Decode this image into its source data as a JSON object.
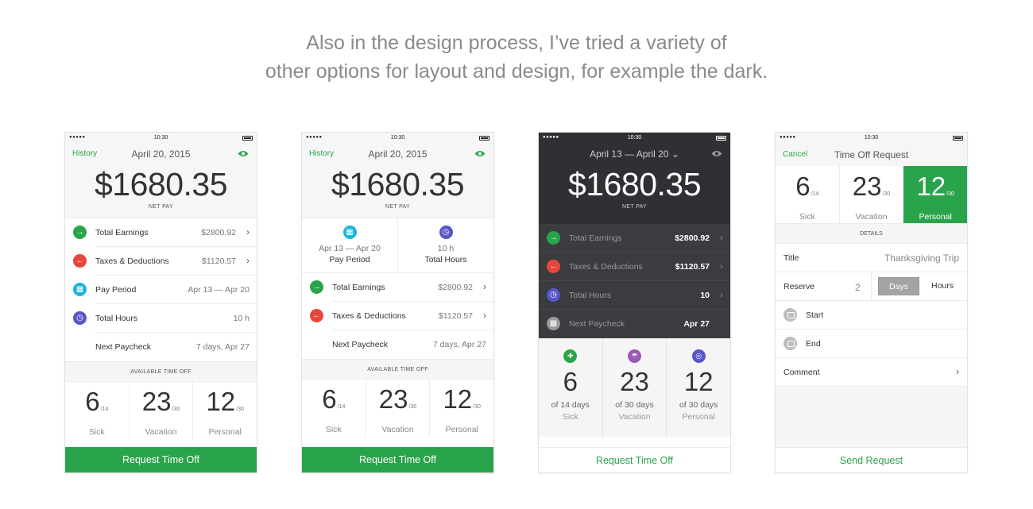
{
  "headline": {
    "line1": "Also in the design process, I’ve tried a variety of",
    "line2": "other options for layout and design, for example the dark."
  },
  "colors": {
    "accent": "#2aa44a",
    "red": "#e8463d",
    "cyan": "#18b4da",
    "violet": "#5a56c8",
    "dark": "#2e3033"
  },
  "status": {
    "dots": "●●●●●",
    "time": "10:30"
  },
  "phone1": {
    "nav_left": "History",
    "title": "April 20, 2015",
    "amount": "$1680.35",
    "netpay": "NET PAY",
    "rows": [
      {
        "icon": "arrow-right-icon",
        "glyph": "→",
        "label": "Total Earnings",
        "value": "$2800.92",
        "chevron": "›"
      },
      {
        "icon": "arrow-left-icon",
        "glyph": "←",
        "label": "Taxes & Deductions",
        "value": "$1120.57",
        "chevron": "›"
      },
      {
        "icon": "calendar-icon",
        "glyph": "▦",
        "label": "Pay Period",
        "value": "Apr 13 — Apr 20"
      },
      {
        "icon": "clock-icon",
        "glyph": "◷",
        "label": "Total Hours",
        "value": "10 h"
      },
      {
        "label": "Next Paycheck",
        "value": "7 days, Apr 27"
      }
    ],
    "section": "AVAILABLE TIME OFF",
    "tiles": [
      {
        "num": "6",
        "of": "/14",
        "label": "Sick"
      },
      {
        "num": "23",
        "of": "/30",
        "label": "Vacation"
      },
      {
        "num": "12",
        "of": "/30",
        "label": "Personal"
      }
    ],
    "cta": "Request Time Off"
  },
  "phone2": {
    "nav_left": "History",
    "title": "April 20, 2015",
    "amount": "$1680.35",
    "netpay": "NET PAY",
    "split": [
      {
        "icon": "calendar-icon",
        "glyph": "▦",
        "sub": "Apr 13 — Apr 20",
        "main": "Pay Period"
      },
      {
        "icon": "clock-icon",
        "glyph": "◷",
        "sub": "10 h",
        "main": "Total Hours"
      }
    ],
    "rows": [
      {
        "icon": "arrow-right-icon",
        "glyph": "→",
        "label": "Total Earnings",
        "value": "$2800.92",
        "chevron": "›"
      },
      {
        "icon": "arrow-left-icon",
        "glyph": "←",
        "label": "Taxes & Deductions",
        "value": "$1120.57",
        "chevron": "›"
      },
      {
        "label": "Next Paycheck",
        "value": "7 days, Apr 27"
      }
    ],
    "section": "AVAILABLE TIME OFF",
    "tiles": [
      {
        "num": "6",
        "of": "/14",
        "label": "Sick"
      },
      {
        "num": "23",
        "of": "/30",
        "label": "Vacation"
      },
      {
        "num": "12",
        "of": "/30",
        "label": "Personal"
      }
    ],
    "cta": "Request Time Off"
  },
  "phone3": {
    "title": "April 13 — April 20",
    "dropdown_glyph": "⌄",
    "amount": "$1680.35",
    "netpay": "NET PAY",
    "rows": [
      {
        "icon": "arrow-right-icon",
        "glyph": "→",
        "label": "Total Earnings",
        "value": "$2800.92",
        "chevron": "›"
      },
      {
        "icon": "arrow-left-icon",
        "glyph": "←",
        "label": "Taxes & Deductions",
        "value": "$1120.57",
        "chevron": "›"
      },
      {
        "icon": "clock-icon",
        "glyph": "◷",
        "label": "Total Hours",
        "value": "10",
        "chevron": "›"
      },
      {
        "icon": "calendar-icon",
        "glyph": "▦",
        "label": "Next Paycheck",
        "value": "Apr 27"
      }
    ],
    "tiles": [
      {
        "icon": "sick-icon",
        "glyph": "✚",
        "num": "6",
        "of": "of 14 days",
        "label": "Sick"
      },
      {
        "icon": "umbrella-icon",
        "glyph": "☂",
        "num": "23",
        "of": "of 30 days",
        "label": "Vacation"
      },
      {
        "icon": "binoculars-icon",
        "glyph": "◎",
        "num": "12",
        "of": "of 30 days",
        "label": "Personal"
      }
    ],
    "cta": "Request Time Off"
  },
  "phone4": {
    "nav_left": "Cancel",
    "title": "Time Off Request",
    "tiles": [
      {
        "num": "6",
        "of": "/14",
        "label": "Sick"
      },
      {
        "num": "23",
        "of": "/30",
        "label": "Vacation"
      },
      {
        "num": "12",
        "of": "/30",
        "label": "Personal"
      }
    ],
    "details": "DETAILS",
    "title_label": "Title",
    "title_value": "Thanksgiving Trip",
    "reserve_label": "Reserve",
    "reserve_value": "2",
    "seg_days": "Days",
    "seg_hours": "Hours",
    "start_label": "Start",
    "end_label": "End",
    "comment_label": "Comment",
    "chevron": "›",
    "cta": "Send Request"
  }
}
